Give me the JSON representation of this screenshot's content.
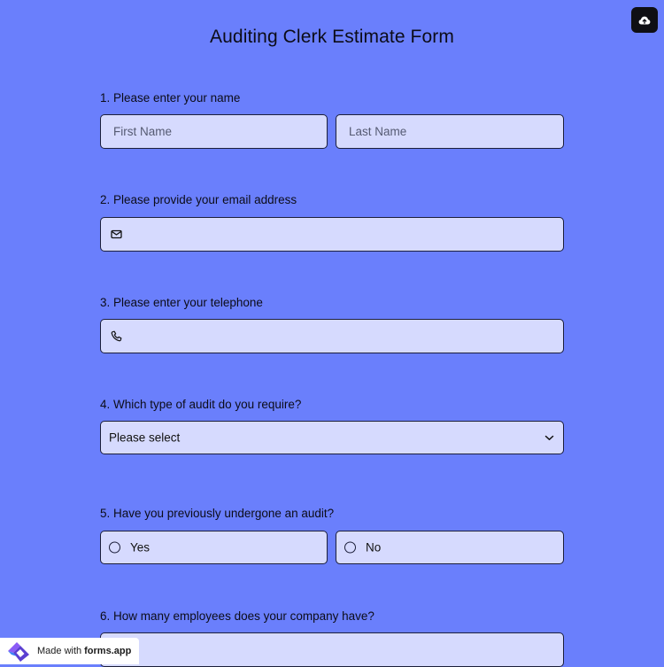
{
  "form": {
    "title": "Auditing Clerk Estimate Form"
  },
  "questions": {
    "q1": {
      "label": "1.  Please enter your name",
      "first_placeholder": "First Name",
      "last_placeholder": "Last Name"
    },
    "q2": {
      "label": "2. Please provide your email address",
      "icon": "mail-icon"
    },
    "q3": {
      "label": "3. Please enter your telephone",
      "icon": "phone-icon"
    },
    "q4": {
      "label": "4. Which type of audit do you require?",
      "selected": "Please select",
      "icon": "chevron-down-icon"
    },
    "q5": {
      "label": "5. Have you previously undergone an audit?",
      "options": [
        "Yes",
        "No"
      ]
    },
    "q6": {
      "label": "6. How many employees does your company have?"
    }
  },
  "toolbar": {
    "save_icon": "cloud-upload-icon"
  },
  "badge": {
    "made_with": "Made with",
    "brand": "forms.app",
    "icon": "forms-app-logo"
  },
  "colors": {
    "background": "#6a7ffc",
    "field_background": "#d6dafe",
    "field_border": "#1c1f3a",
    "save_button": "#0f0f14"
  }
}
